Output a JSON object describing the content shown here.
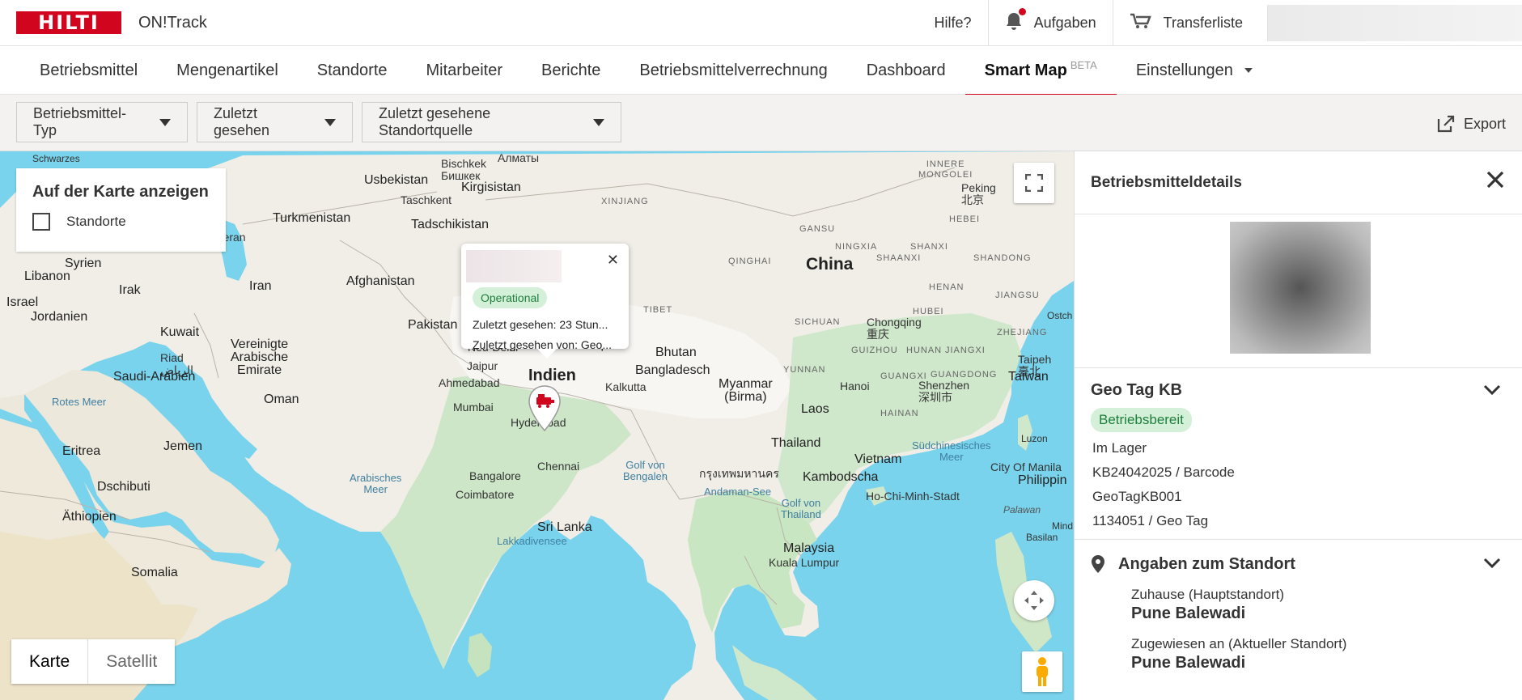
{
  "topbar": {
    "logo": "HILTI",
    "app_name": "ON!Track",
    "help": "Hilfe?",
    "tasks": "Aufgaben",
    "transfer": "Transferliste"
  },
  "nav": {
    "items": [
      "Betriebsmittel",
      "Mengenartikel",
      "Standorte",
      "Mitarbeiter",
      "Berichte",
      "Betriebsmittelverrechnung",
      "Dashboard",
      "Smart Map",
      "Einstellungen"
    ],
    "beta": "BETA"
  },
  "filters": {
    "type": "Betriebsmittel-Typ",
    "last_seen": "Zuletzt gesehen",
    "last_source": "Zuletzt gesehene Standortquelle",
    "export": "Export"
  },
  "map": {
    "legend_title": "Auf der Karte anzeigen",
    "legend_option": "Standorte",
    "map_type_map": "Karte",
    "map_type_satellite": "Satellit",
    "labels": {
      "schwarzes": "Schwarzes",
      "usbekistan": "Usbekistan",
      "bischkek": "Bischkek\nБишкек",
      "almaty": "Алматы",
      "kirgisistan": "Kirgisistan",
      "taschkent": "Taschkent",
      "turkmenistan": "Turkmenistan",
      "tadschikistan": "Tadschikistan",
      "xinjiang": "XINJIANG",
      "innere_mongolei": "INNERE\nMONGOLEI",
      "peking": "Peking\n北京",
      "hebei": "HEBEI",
      "teheran": "Teheran",
      "syrien": "Syrien",
      "libanon": "Libanon",
      "afghanistan": "Afghanistan",
      "gansu": "GANSU",
      "ningxia": "NINGXIA",
      "shanxi": "SHANXI",
      "shaanxi": "SHAANXI",
      "shandong": "SHANDONG",
      "qinghai": "QINGHAI",
      "irak": "Irak",
      "iran": "Iran",
      "china": "China",
      "israel": "Israel",
      "jordanien": "Jordanien",
      "henan": "HENAN",
      "jiangsu": "JIANGSU",
      "kuwait": "Kuwait",
      "pakistan": "Pakistan",
      "tibet": "TIBET",
      "hubei": "HUBEI",
      "sichuan": "SICHUAN",
      "chongqing": "Chongqing\n重庆",
      "zhejiang": "ZHEJIANG",
      "neu_delhi": "Neu-Delhi",
      "nepal": "Nepal",
      "bhutan": "Bhutan",
      "guizhou": "GUIZHOU",
      "hunan": "HUNAN",
      "jiangxi": "JIANGXI",
      "riad": "Riad\nالرياض",
      "vae": "Vereinigte\nArabische\nEmirate",
      "jaipur": "Jaipur",
      "taipeh": "Taipeh\n臺北",
      "saudi": "Saudi-Arabien",
      "bangladesch": "Bangladesch",
      "yunnan": "YUNNAN",
      "guangxi": "GUANGXI",
      "guangdong": "GUANGDONG",
      "taiwan": "Taiwan",
      "ahmedabad": "Ahmedabad",
      "indien": "Indien",
      "kalkutta": "Kalkutta",
      "myanmar": "Myanmar\n(Birma)",
      "hanoi": "Hanoi",
      "shenzhen": "Shenzhen\n深圳市",
      "oman": "Oman",
      "rotes_meer": "Rotes Meer",
      "mumbai": "Mumbai",
      "laos": "Laos",
      "hainan": "HAINAN",
      "hyderabad": "Hyderabad",
      "eritrea": "Eritrea",
      "jemen": "Jemen",
      "thailand": "Thailand",
      "suedchinesisches": "Südchinesisches\nMeer",
      "luzon": "Luzon",
      "chennai": "Chennai",
      "golf_bengalen": "Golf von\nBengalen",
      "bangkok": "กรุงเทพมหานคร",
      "vietnam": "Vietnam",
      "city_manila": "City Of Manila",
      "philippin": "Philippin",
      "arabisches": "Arabisches\nMeer",
      "bangalore": "Bangalore",
      "kambodscha": "Kambodscha",
      "dschibuti": "Dschibuti",
      "coimbatore": "Coimbatore",
      "andaman": "Andaman-See",
      "hcmc": "Ho-Chi-Minh-Stadt",
      "golf_thailand": "Golf von\nThailand",
      "palawan": "Palawan",
      "aethiopien": "Äthiopien",
      "sri_lanka": "Sri Lanka",
      "mind": "Mind",
      "lakkadivensee": "Lakkadivensee",
      "basilan": "Basilan",
      "malaysia": "Malaysia",
      "kuala": "Kuala Lumpur",
      "somalia": "Somalia",
      "ostch": "Ostch"
    }
  },
  "popup": {
    "status": "Operational",
    "last_seen": "Zuletzt gesehen: 23 Stun...",
    "last_seen_by": "Zuletzt gesehen von: Geo..."
  },
  "panel": {
    "header": "Betriebsmitteldetails",
    "asset": {
      "title": "Geo Tag KB",
      "status": "Betriebsbereit",
      "lines": [
        "Im Lager",
        "KB24042025 / Barcode",
        "GeoTagKB001",
        "1134051 / Geo Tag"
      ]
    },
    "location": {
      "title": "Angaben zum Standort",
      "home_label": "Zuhause (Hauptstandort)",
      "home_value": "Pune Balewadi",
      "assigned_label": "Zugewiesen an (Aktueller Standort)",
      "assigned_value": "Pune Balewadi"
    }
  },
  "colors": {
    "brand": "#d2051e",
    "water": "#7ad3ec",
    "land": "#f1eee7",
    "green_status_bg": "#d4f0d8",
    "green_status_fg": "#1e7f3c"
  }
}
